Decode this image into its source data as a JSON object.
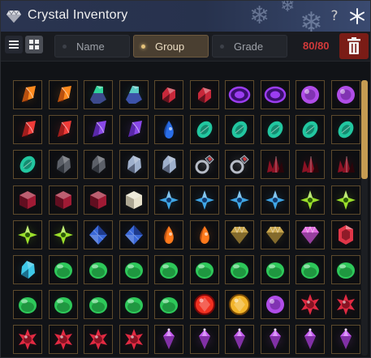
{
  "window": {
    "title": "Crystal Inventory",
    "title_icon": "diamond-icon",
    "help_label": "?",
    "close_icon": "snowflake-close-icon"
  },
  "toolbar": {
    "view_list_icon": "list-view-icon",
    "view_grid_icon": "grid-view-icon",
    "tabs": [
      {
        "label": "Name",
        "active": false
      },
      {
        "label": "Group",
        "active": true
      },
      {
        "label": "Grade",
        "active": false
      }
    ],
    "count": "80/80",
    "trash_icon": "trash-icon"
  },
  "colors": {
    "accent_gold": "#e5c27a",
    "count_red": "#d23a3a",
    "trash_bg": "#7a1c16",
    "slot_border": "#5d4a2c"
  },
  "inventory": {
    "rows": [
      [
        "amber-shard",
        "amber-shard",
        "green-ore",
        "blue-ore",
        "ruby-chip",
        "ruby-chip",
        "purple-oval",
        "purple-oval",
        "purple-round",
        "purple-round"
      ],
      [
        "red-shard",
        "red-shard",
        "violet-shard",
        "violet-shard",
        "blue-drop",
        "emerald-oval",
        "emerald-oval",
        "emerald-oval",
        "emerald-oval",
        "emerald-oval"
      ],
      [
        "emerald-oval",
        "grey-rough",
        "grey-rough",
        "silver-rough",
        "silver-rough",
        "silver-ring",
        "silver-ring",
        "ruby-cluster",
        "ruby-cluster",
        "ruby-cluster"
      ],
      [
        "ruby-cube",
        "ruby-cube",
        "ruby-cube",
        "white-cube",
        "blue-star",
        "blue-star",
        "blue-star",
        "blue-star",
        "lime-star",
        "lime-star"
      ],
      [
        "lime-star",
        "lime-star",
        "blue-mosaic",
        "blue-mosaic",
        "orange-drop",
        "orange-drop",
        "gold-gem",
        "gold-gem",
        "pink-gem",
        "crimson-gem"
      ],
      [
        "cyan-rough",
        "green-orb",
        "green-orb",
        "green-orb",
        "green-orb",
        "green-orb",
        "green-orb",
        "green-orb",
        "green-orb",
        "green-orb"
      ],
      [
        "green-orb",
        "green-orb",
        "green-orb",
        "green-orb",
        "green-orb",
        "red-round",
        "gold-round",
        "purple-round",
        "red-star",
        "red-star"
      ],
      [
        "red-star",
        "red-star",
        "red-star",
        "red-star",
        "purple-ornate",
        "purple-ornate",
        "purple-ornate",
        "purple-ornate",
        "purple-ornate",
        "purple-ornate"
      ]
    ],
    "scroll_position": 0
  }
}
